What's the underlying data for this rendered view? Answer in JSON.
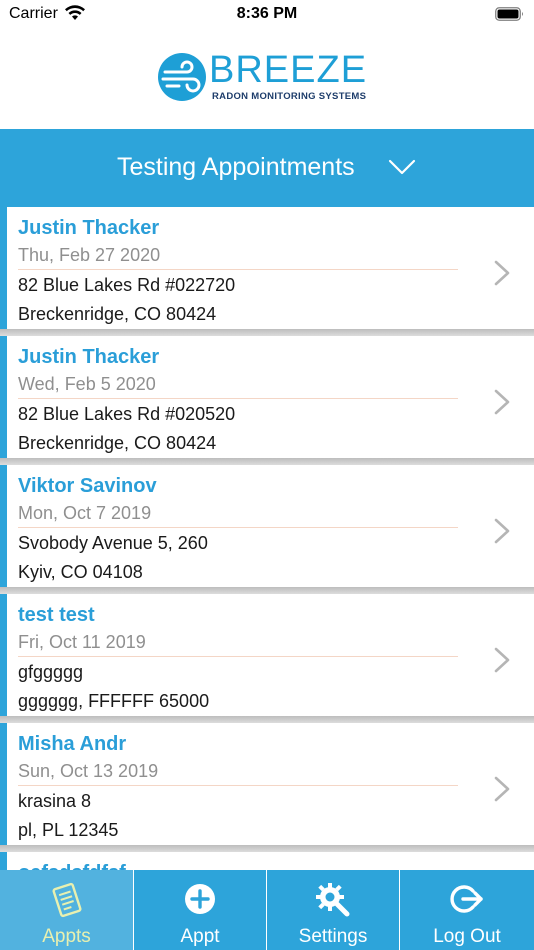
{
  "status_bar": {
    "carrier": "Carrier",
    "time": "8:36 PM"
  },
  "logo": {
    "name": "BREEZE",
    "subtitle": "RADON MONITORING SYSTEMS",
    "brand_color": "#1e9fd6",
    "icon": "wind-swirl-icon"
  },
  "header": {
    "title": "Testing Appointments",
    "background": "#2da4da",
    "icon": "chevron-down-icon"
  },
  "appointments": [
    {
      "name": "Justin Thacker",
      "date": "Thu, Feb 27 2020",
      "address1": "82 Blue Lakes Rd #022720",
      "address2": "Breckenridge, CO 80424"
    },
    {
      "name": "Justin Thacker",
      "date": "Wed, Feb 5 2020",
      "address1": "82 Blue Lakes Rd #020520",
      "address2": "Breckenridge, CO 80424"
    },
    {
      "name": "Viktor Savinov",
      "date": "Mon, Oct 7 2019",
      "address1": "Svobody Avenue 5, 260",
      "address2": "Kyiv, CO 04108"
    },
    {
      "name": "test test",
      "date": "Fri, Oct 11 2019",
      "address1": "gfggggg",
      "address2": "gggggg, FFFFFF 65000"
    },
    {
      "name": "Misha Andr",
      "date": "Sun, Oct 13 2019",
      "address1": "krasina 8",
      "address2": "pl, PL 12345"
    }
  ],
  "partial_item_name": "oafsdsfdfsf",
  "tabs": [
    {
      "label": "Appts",
      "icon": "appointments-list-icon",
      "active": true
    },
    {
      "label": "Appt",
      "icon": "add-circle-icon",
      "active": false
    },
    {
      "label": "Settings",
      "icon": "settings-gear-icon",
      "active": false
    },
    {
      "label": "Log Out",
      "icon": "logout-icon",
      "active": false
    }
  ]
}
